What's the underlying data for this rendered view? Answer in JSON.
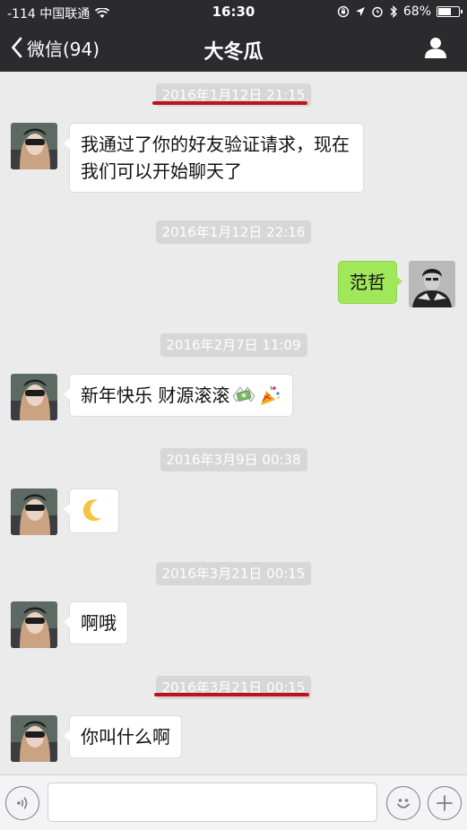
{
  "status_bar": {
    "carrier": "-114 中国联通",
    "time": "16:30",
    "battery_text": "68%",
    "battery_level": 0.68
  },
  "nav": {
    "back_label": "微信(94)",
    "title": "大冬瓜"
  },
  "messages": [
    {
      "time": "2016年1月12日 21:15",
      "sender": "friend",
      "text": "我通过了你的好友验证请求，现在我们可以开始聊天了"
    },
    {
      "time": "2016年1月12日 22:16",
      "sender": "me",
      "text": "范哲"
    },
    {
      "time": "2016年2月7日 11:09",
      "sender": "friend",
      "text": "新年快乐 财源滚滚"
    },
    {
      "time": "2016年3月9日 00:38",
      "sender": "friend",
      "text": ""
    },
    {
      "time": "2016年3月21日 00:15",
      "sender": "friend",
      "text": "啊哦"
    },
    {
      "time": "2016年3月21日 00:15",
      "sender": "friend",
      "text": "你叫什么啊"
    }
  ],
  "emoji": {
    "money": "money-with-wings-icon",
    "party": "party-popper-icon",
    "moon": "crescent-moon-icon"
  },
  "annotation_color": "#c0121c",
  "colors": {
    "nav_background": "#2b2b2e",
    "chat_background": "#ebebeb",
    "my_bubble": "#a0e75a",
    "friend_bubble": "#ffffff"
  },
  "input": {
    "placeholder": ""
  }
}
